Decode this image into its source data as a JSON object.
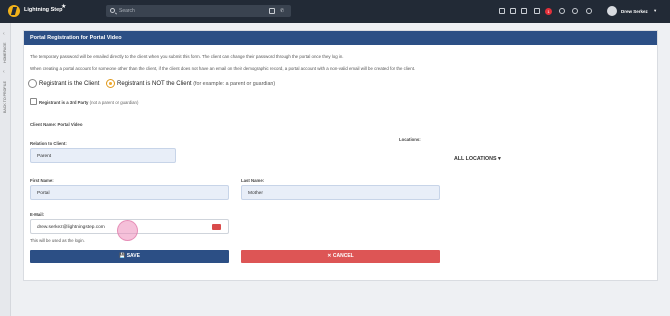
{
  "app": {
    "name": "Lightning Step"
  },
  "search": {
    "placeholder": "Search"
  },
  "topbar": {
    "notification_count": "1",
    "user_name": "Drew Serkez"
  },
  "side_tabs": {
    "homepage": "HOMEPAGE",
    "back_to_profile": "BACK TO PROFILE"
  },
  "form": {
    "title": "Portal Registration for Portal Video",
    "info_line1": "The temporary password will be emailed directly to the client when you submit this form. The client can change their password through the portal once they log in.",
    "info_line2": "When creating a portal account for someone other than the client, if the client does not have an email on their demographic record, a portal account with a non-valid email will be created for the client.",
    "radio_client": "Registrant is the Client",
    "radio_not_client": "Registrant is NOT the Client",
    "radio_not_client_sub": "(for example: a parent or guardian)",
    "third_party": "Registrant is a 3rd Party",
    "third_party_sub": "(not a parent or guardian)",
    "client_name_label": "Client Name: Portal Video",
    "relation_label": "Relation to Client:",
    "relation_value": "Parent",
    "locations_label": "Locations:",
    "locations_button": "ALL LOCATIONS ▾",
    "first_name_label": "First Name:",
    "first_name_value": "Portal",
    "last_name_label": "Last Name:",
    "last_name_value": "Mother",
    "email_label": "E-Mail:",
    "email_value": "drew.serkez@lightningstep.com",
    "email_hint": "This will be used as the login.",
    "save_label": "SAVE",
    "cancel_label": "CANCEL"
  },
  "colors": {
    "header": "#2c4f85",
    "topbar": "#222a36",
    "save": "#2c4f85",
    "cancel": "#dd5555",
    "accent": "#f0a82a"
  }
}
